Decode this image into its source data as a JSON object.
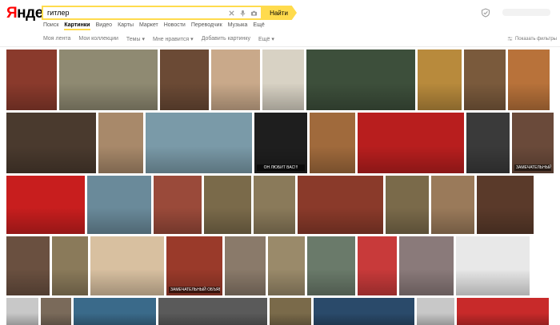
{
  "header": {
    "logo_first": "Я",
    "logo_rest": "ндекс",
    "search_value": "гитлер",
    "search_button": "Найти"
  },
  "tabs": [
    {
      "label": "Поиск",
      "active": false
    },
    {
      "label": "Картинки",
      "active": true
    },
    {
      "label": "Видео",
      "active": false
    },
    {
      "label": "Карты",
      "active": false
    },
    {
      "label": "Маркет",
      "active": false
    },
    {
      "label": "Новости",
      "active": false
    },
    {
      "label": "Переводчик",
      "active": false
    },
    {
      "label": "Музыка",
      "active": false
    },
    {
      "label": "Ещё",
      "active": false
    }
  ],
  "subnav": [
    "Моя лента",
    "Мои коллекции",
    "Темы ▾",
    "Мне нравится ▾",
    "Добавить картинку",
    "Ещё ▾"
  ],
  "filters_label": "Показать фильтры",
  "icons": {
    "clear": "close-icon",
    "voice": "microphone-icon",
    "camera": "camera-icon",
    "shield": "shield-icon",
    "filters": "sliders-icon"
  },
  "rows": [
    {
      "tiles": [
        {
          "w": 63,
          "c": "#8a3a2c"
        },
        {
          "w": 123,
          "c": "#8f8a72"
        },
        {
          "w": 61,
          "c": "#6b4a35"
        },
        {
          "w": 61,
          "c": "#c9a98a"
        },
        {
          "w": 52,
          "c": "#d8d2c4"
        },
        {
          "w": 136,
          "c": "#3d4f3b"
        },
        {
          "w": 55,
          "c": "#b88a3c"
        },
        {
          "w": 52,
          "c": "#7a5a3c"
        },
        {
          "w": 52,
          "c": "#b8723a"
        }
      ]
    },
    {
      "tiles": [
        {
          "w": 112,
          "c": "#4a3a2e"
        },
        {
          "w": 56,
          "c": "#a8896a"
        },
        {
          "w": 133,
          "c": "#7a9aa8"
        },
        {
          "w": 66,
          "c": "#1e1e1e",
          "caption": "ОН ЛЮБИТ ВАС!!!"
        },
        {
          "w": 57,
          "c": "#a06a3c"
        },
        {
          "w": 133,
          "c": "#b81e1e"
        },
        {
          "w": 54,
          "c": "#3a3a3a"
        },
        {
          "w": 52,
          "c": "#6a4a3a",
          "caption": "ЗАМЕЧАТЕЛЬНЫЙ ОБЪЯВИ"
        }
      ]
    },
    {
      "tiles": [
        {
          "w": 98,
          "c": "#c81e1e"
        },
        {
          "w": 80,
          "c": "#6a8a9a"
        },
        {
          "w": 60,
          "c": "#9a4a3a"
        },
        {
          "w": 59,
          "c": "#7a6a4a"
        },
        {
          "w": 52,
          "c": "#8a7a5a"
        },
        {
          "w": 107,
          "c": "#8a3a2a"
        },
        {
          "w": 54,
          "c": "#7a6a4a"
        },
        {
          "w": 54,
          "c": "#9a7a5a"
        },
        {
          "w": 71,
          "c": "#5a3a2a"
        }
      ]
    },
    {
      "tiles": [
        {
          "w": 54,
          "c": "#6a5040"
        },
        {
          "w": 45,
          "c": "#8a7a5a"
        },
        {
          "w": 92,
          "c": "#d8c0a0"
        },
        {
          "w": 70,
          "c": "#9a3a2a",
          "caption": "ЗАМЕЧАТЕЛЬНЫЙ ОБЪЯВИ"
        },
        {
          "w": 51,
          "c": "#8a7a6a"
        },
        {
          "w": 46,
          "c": "#9a8a6a"
        },
        {
          "w": 60,
          "c": "#6a7a6a"
        },
        {
          "w": 49,
          "c": "#c83a3a"
        },
        {
          "w": 68,
          "c": "#8a7a7a"
        },
        {
          "w": 92,
          "c": "#e8e8e8"
        }
      ]
    },
    {
      "tiles": [
        {
          "w": 40,
          "c": "#c8c8c8"
        },
        {
          "w": 38,
          "c": "#7a6a5a"
        },
        {
          "w": 103,
          "c": "#3a6a8a"
        },
        {
          "w": 136,
          "c": "#5a5a5a"
        },
        {
          "w": 52,
          "c": "#7a6a4a"
        },
        {
          "w": 126,
          "c": "#2a4a6a"
        },
        {
          "w": 47,
          "c": "#c8c8c8"
        },
        {
          "w": 115,
          "c": "#c82a2a"
        }
      ]
    }
  ]
}
